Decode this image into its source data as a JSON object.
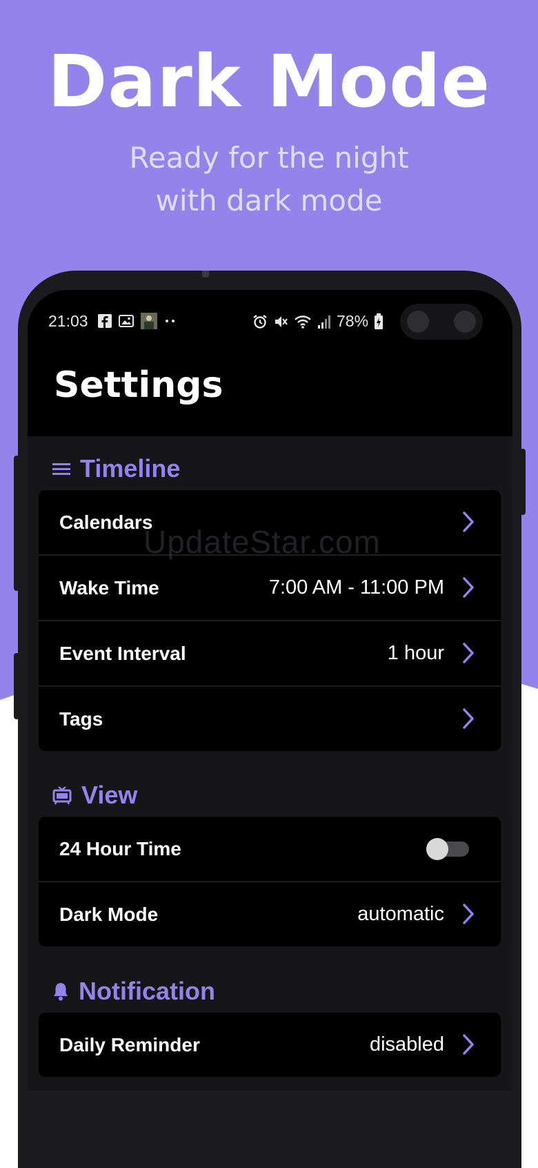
{
  "promo": {
    "title": "Dark Mode",
    "subtitle_line1": "Ready for the night",
    "subtitle_line2": "with dark mode"
  },
  "status_bar": {
    "time": "21:03",
    "battery": "78%",
    "icons_left": [
      "facebook-icon",
      "gallery-icon",
      "photo-thumb-icon",
      "more-dots-icon"
    ],
    "icons_right": [
      "alarm-icon",
      "mute-icon",
      "wifi-icon",
      "signal-icon",
      "battery-icon"
    ]
  },
  "header": {
    "title": "Settings"
  },
  "sections": [
    {
      "title": "Timeline",
      "icon": "menu-lines-icon",
      "rows": [
        {
          "label": "Calendars",
          "value": ""
        },
        {
          "label": "Wake Time",
          "value": "7:00 AM - 11:00 PM"
        },
        {
          "label": "Event Interval",
          "value": "1 hour"
        },
        {
          "label": "Tags",
          "value": ""
        }
      ]
    },
    {
      "title": "View",
      "icon": "tv-icon",
      "rows": [
        {
          "label": "24 Hour Time",
          "value": "",
          "toggle_on": false
        },
        {
          "label": "Dark Mode",
          "value": "automatic"
        }
      ]
    },
    {
      "title": "Notification",
      "icon": "bell-icon",
      "rows": [
        {
          "label": "Daily Reminder",
          "value": "disabled"
        }
      ]
    }
  ],
  "watermark": "UpdateStar.com",
  "colors": {
    "accent": "#9583ec",
    "screen_bg": "#161618",
    "card_bg": "#000000",
    "text": "#ffffff"
  }
}
